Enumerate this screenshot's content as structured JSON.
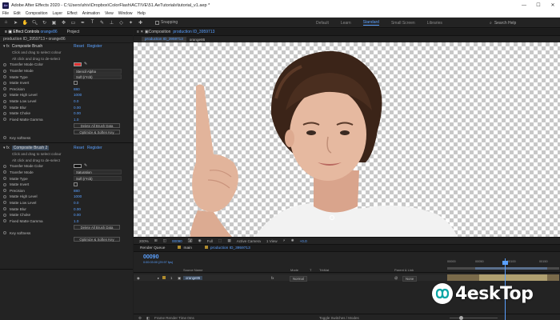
{
  "window": {
    "title": "Adobe After Effects 2020 - C:\\Users\\shiv\\Dropbox\\ColorFlash\\ACTIVE\\51.AeTutorials\\tutorial_v1.aep *",
    "logo": "Ae",
    "controls": [
      "—",
      "☐",
      "✕"
    ]
  },
  "menu": [
    "File",
    "Edit",
    "Composition",
    "Layer",
    "Effect",
    "Animation",
    "View",
    "Window",
    "Help"
  ],
  "toolbar": {
    "snapping": "Snapping",
    "workspaces": [
      "Default",
      "Learn",
      "Standard",
      "Small Screen",
      "Libraries"
    ],
    "active_workspace": "Standard",
    "search": "Search Help"
  },
  "effect_controls": {
    "tab_effect": "Effect Controls",
    "tab_effect_target": "orange86",
    "tab_project": "Project",
    "subheader": "production ID_3959713 • orange86",
    "brush1": {
      "name": "Composite Brush",
      "reset": "Reset",
      "register": "Register",
      "rows": [
        {
          "kind": "note",
          "label": "Click and drag to select colour"
        },
        {
          "kind": "note",
          "label": "Alt click and drag to de-select"
        },
        {
          "kind": "color",
          "label": "Transfer Mode Color",
          "swatch": "#e03030"
        },
        {
          "kind": "dropdown",
          "label": "Transfer Mode",
          "value": "Stencil Alpha"
        },
        {
          "kind": "dropdown",
          "label": "Matte Type",
          "value": "Soft (rYcb)"
        },
        {
          "kind": "checkbox",
          "label": "Matte Invert"
        },
        {
          "kind": "value",
          "label": "Precision",
          "value": "880"
        },
        {
          "kind": "value",
          "label": "Matte High Level",
          "value": "1000"
        },
        {
          "kind": "value",
          "label": "Matte Low Level",
          "value": "0.0"
        },
        {
          "kind": "value",
          "label": "Matte Blur",
          "value": "0.00"
        },
        {
          "kind": "value",
          "label": "Matte Choke",
          "value": "0.00"
        },
        {
          "kind": "value",
          "label": "Fixed Matte Gamma",
          "value": "1.0"
        },
        {
          "kind": "button",
          "label": "",
          "value": "Delete All Brush Data"
        },
        {
          "kind": "button",
          "label": "",
          "value": "Optimize & Soften Key"
        },
        {
          "kind": "value",
          "label": "Key softness",
          "value": ""
        }
      ]
    },
    "brush2": {
      "name": "Composite Brush 2",
      "reset": "Reset",
      "register": "Register",
      "rows": [
        {
          "kind": "note",
          "label": "Click and drag to select colour"
        },
        {
          "kind": "note",
          "label": "Alt click and drag to de-select"
        },
        {
          "kind": "color",
          "label": "Transfer Mode Color",
          "swatch": "#111111"
        },
        {
          "kind": "dropdown",
          "label": "Transfer Mode",
          "value": "Saturation"
        },
        {
          "kind": "dropdown",
          "label": "Matte Type",
          "value": "Soft (rYcb)"
        },
        {
          "kind": "checkbox",
          "label": "Matte Invert"
        },
        {
          "kind": "value",
          "label": "Precision",
          "value": "880"
        },
        {
          "kind": "value",
          "label": "Matte High Level",
          "value": "1000"
        },
        {
          "kind": "value",
          "label": "Matte Low Level",
          "value": "0.0"
        },
        {
          "kind": "value",
          "label": "Matte Blur",
          "value": "0.00"
        },
        {
          "kind": "value",
          "label": "Matte Choke",
          "value": "0.00"
        },
        {
          "kind": "value",
          "label": "Fixed Matte Gamma",
          "value": "1.0"
        },
        {
          "kind": "button",
          "label": "",
          "value": "Delete All Brush Data"
        },
        {
          "kind": "value",
          "label": "Key softness",
          "value": ""
        },
        {
          "kind": "button",
          "label": "",
          "value": "Optimize & Soften Key"
        }
      ]
    }
  },
  "composition": {
    "tab_prefix": "Composition",
    "tab_name": "production ID_3959713",
    "crumb_active": "production ID_3959713",
    "crumb_other": "orange86"
  },
  "viewer_bar": {
    "zoom": "200%",
    "timecode": "00090",
    "resolution": "Full",
    "camera": "Active Camera",
    "views": "1 View",
    "offset": "+0.0"
  },
  "timeline": {
    "tabs": [
      "Render Queue",
      "main",
      "production ID_3959713"
    ],
    "active_tab": "production ID_3959713",
    "timecode": "00090",
    "fps_note": "0:00:03:00 (29.97 fps)",
    "columns": [
      "Source Name",
      "Mode",
      "T",
      "TrkMat",
      "Parent & Link"
    ],
    "ruler": [
      "00000",
      "00050",
      "00100",
      "00150"
    ],
    "layer": {
      "index": "1",
      "name": "orange86",
      "mode": "Normal",
      "parent": "None"
    },
    "bottom_left": "Frame Render Time 0ms",
    "bottom_toggle": "Toggle Switches / Modes"
  },
  "watermark": {
    "text": "4eskTop"
  }
}
